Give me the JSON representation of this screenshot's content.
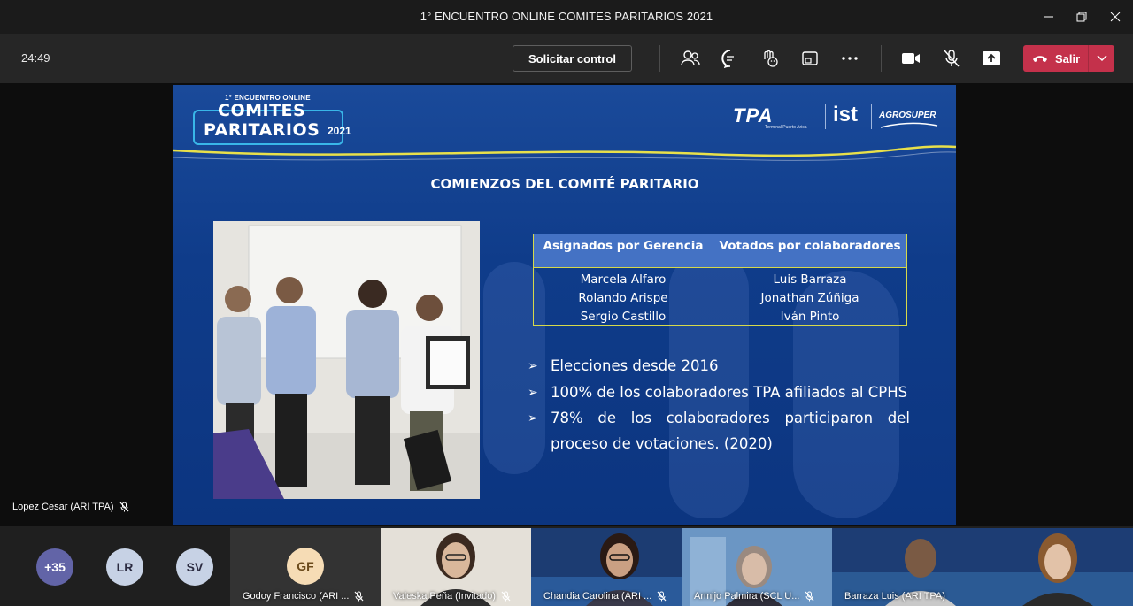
{
  "window": {
    "title": "1° ENCUENTRO ONLINE COMITES PARITARIOS 2021"
  },
  "toolbar": {
    "timer": "24:49",
    "request_control": "Solicitar control",
    "leave_label": "Salir"
  },
  "slide": {
    "logo_small": "1° ENCUENTRO ONLINE",
    "logo_line1": "COMITES",
    "logo_line2": "PARITARIOS",
    "logo_year": "2021",
    "brand_tpa": "TPA",
    "brand_tpa_sub": "Terminal Puerto Arica",
    "brand_ist": "ist",
    "brand_agro": "AGROSUPER",
    "title": "COMIENZOS DEL COMITÉ PARITARIO",
    "table": {
      "headers": [
        "Asignados por Gerencia",
        "Votados por colaboradores"
      ],
      "col1": [
        "Marcela Alfaro",
        "Rolando Arispe",
        "Sergio Castillo"
      ],
      "col2": [
        "Luis Barraza",
        "Jonathan Zúñiga",
        "Iván Pinto"
      ]
    },
    "bullets": [
      "Elecciones desde 2016",
      "100% de los colaboradores TPA afiliados al CPHS",
      " 78% de los colaboradores participaron del proceso de votaciones. (2020)"
    ]
  },
  "speaker": {
    "name": "Lopez Cesar (ARI TPA)"
  },
  "participants": {
    "overflow": "+35",
    "lr": "LR",
    "sv": "SV",
    "gf_initials": "GF",
    "gf_name": "Godoy Francisco (ARI ...",
    "valeska": "Valeska Peña (Invitado)",
    "chandia": "Chandia Carolina (ARI ...",
    "armijo": "Armijo Palmira (SCL U...",
    "barraza": "Barraza Luis (ARI TPA)"
  },
  "colors": {
    "leave": "#c4314b",
    "slide_blue": "#0f3c8a",
    "table_header": "#4472c4",
    "table_border": "#d6d94a",
    "overflow_avatar": "#6264a7"
  }
}
